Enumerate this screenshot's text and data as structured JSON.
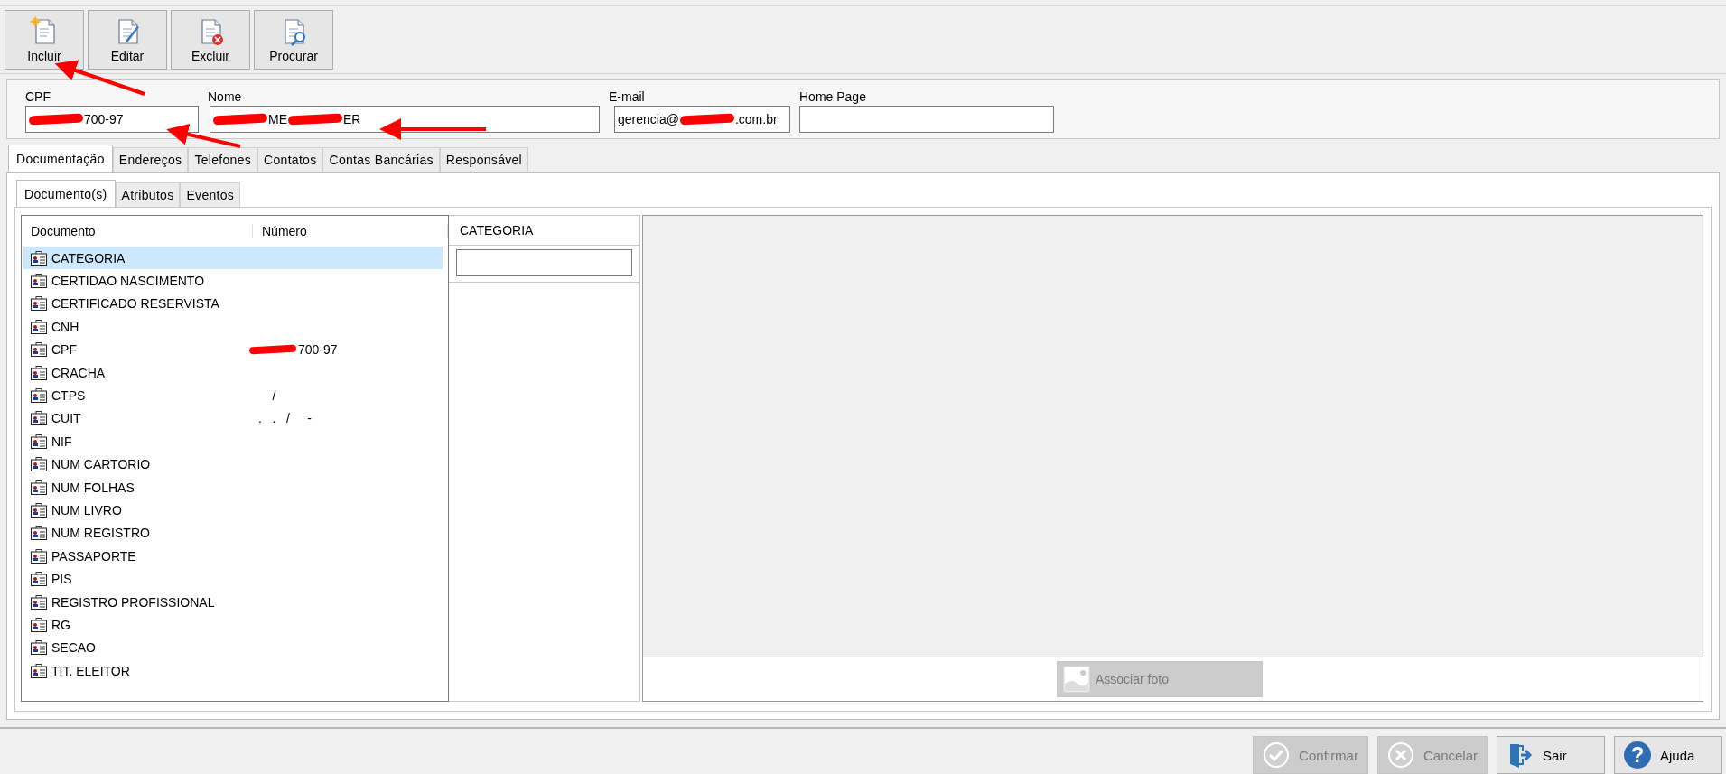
{
  "toolbar": [
    {
      "label": "Incluir",
      "kind": "new"
    },
    {
      "label": "Editar",
      "kind": "edit"
    },
    {
      "label": "Excluir",
      "kind": "delete"
    },
    {
      "label": "Procurar",
      "kind": "search"
    }
  ],
  "fields": [
    {
      "label": "CPF",
      "segments": [
        {
          "kind": "redacted"
        },
        {
          "kind": "text",
          "text": "700-97"
        }
      ]
    },
    {
      "label": "Nome",
      "segments": [
        {
          "kind": "redacted"
        },
        {
          "kind": "text",
          "text": "ME"
        },
        {
          "kind": "redacted"
        },
        {
          "kind": "text",
          "text": "ER"
        }
      ]
    },
    {
      "label": "E-mail",
      "segments": [
        {
          "kind": "text",
          "text": "gerencia@"
        },
        {
          "kind": "redacted"
        },
        {
          "kind": "text",
          "text": ".com.br"
        }
      ]
    },
    {
      "label": "Home Page"
    }
  ],
  "tabs": [
    {
      "label": "Documentação",
      "selected": true
    },
    {
      "label": "Endereços",
      "selected": false
    },
    {
      "label": "Telefones",
      "selected": false
    },
    {
      "label": "Contatos",
      "selected": false
    },
    {
      "label": "Contas Bancárias",
      "selected": false
    },
    {
      "label": "Responsável",
      "selected": false
    }
  ],
  "subtabs": [
    {
      "label": "Documento(s)",
      "selected": true
    },
    {
      "label": "Atributos",
      "selected": false
    },
    {
      "label": "Eventos",
      "selected": false
    }
  ],
  "table": {
    "columns": [
      "Documento",
      "Número"
    ],
    "rows": [
      {
        "documento": "CATEGORIA",
        "numero": "",
        "selected": true
      },
      {
        "documento": "CERTIDAO NASCIMENTO",
        "numero": "",
        "selected": false
      },
      {
        "documento": "CERTIFICADO RESERVISTA",
        "numero": "",
        "selected": false
      },
      {
        "documento": "CNH",
        "numero": "",
        "selected": false
      },
      {
        "documento": "CPF",
        "numero": "700-97",
        "redacted": true,
        "selected": false
      },
      {
        "documento": "CRACHA",
        "numero": "",
        "selected": false
      },
      {
        "documento": "CTPS",
        "numero": "     /",
        "selected": false
      },
      {
        "documento": "CUIT",
        "numero": " .   .   /     -",
        "selected": false
      },
      {
        "documento": "NIF",
        "numero": "",
        "selected": false
      },
      {
        "documento": "NUM CARTORIO",
        "numero": "",
        "selected": false
      },
      {
        "documento": "NUM FOLHAS",
        "numero": "",
        "selected": false
      },
      {
        "documento": "NUM LIVRO",
        "numero": "",
        "selected": false
      },
      {
        "documento": "NUM REGISTRO",
        "numero": "",
        "selected": false
      },
      {
        "documento": "PASSAPORTE",
        "numero": "",
        "selected": false
      },
      {
        "documento": "PIS",
        "numero": "",
        "selected": false
      },
      {
        "documento": "REGISTRO PROFISSIONAL",
        "numero": "",
        "selected": false
      },
      {
        "documento": "RG",
        "numero": "",
        "selected": false
      },
      {
        "documento": "SECAO",
        "numero": "",
        "selected": false
      },
      {
        "documento": "TIT. ELEITOR",
        "numero": "",
        "selected": false
      }
    ]
  },
  "detail": {
    "header": "CATEGORIA"
  },
  "photo": {
    "button": "Associar foto",
    "disabled": true
  },
  "footer": [
    {
      "label": "Confirmar",
      "kind": "confirm",
      "disabled": true
    },
    {
      "label": "Cancelar",
      "kind": "cancel",
      "disabled": true
    },
    {
      "label": "Sair",
      "kind": "exit",
      "disabled": false
    },
    {
      "label": "Ajuda",
      "kind": "help",
      "disabled": false,
      "glyph": "?"
    }
  ]
}
